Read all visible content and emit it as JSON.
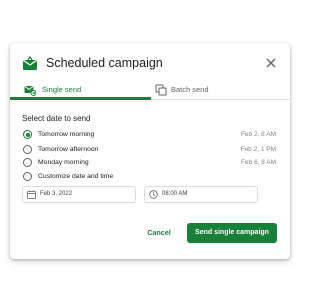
{
  "dialog": {
    "title": "Scheduled campaign",
    "header_icon": "envelope-schedule-icon",
    "close_icon": "close-icon"
  },
  "tabs": [
    {
      "label": "Single send",
      "icon": "envelope-send-icon",
      "active": true
    },
    {
      "label": "Batch send",
      "icon": "copy-stack-icon",
      "active": false
    }
  ],
  "section": {
    "title": "Select date to send"
  },
  "options": [
    {
      "label": "Tomorrow morning",
      "date": "Feb 2, 8 AM",
      "selected": true
    },
    {
      "label": "Tomorrow afternoon",
      "date": "Feb 2, 1 PM",
      "selected": false
    },
    {
      "label": "Monday morning",
      "date": "Feb 6, 8 AM",
      "selected": false
    },
    {
      "label": "Customize date and time",
      "date": "",
      "selected": false
    }
  ],
  "custom": {
    "date_value": "Feb 3, 2022",
    "time_value": "08:00 AM"
  },
  "actions": {
    "cancel_label": "Cancel",
    "send_label": "Send single campaign"
  },
  "colors": {
    "accent": "#188038",
    "text": "#202124",
    "muted": "#80868b"
  }
}
